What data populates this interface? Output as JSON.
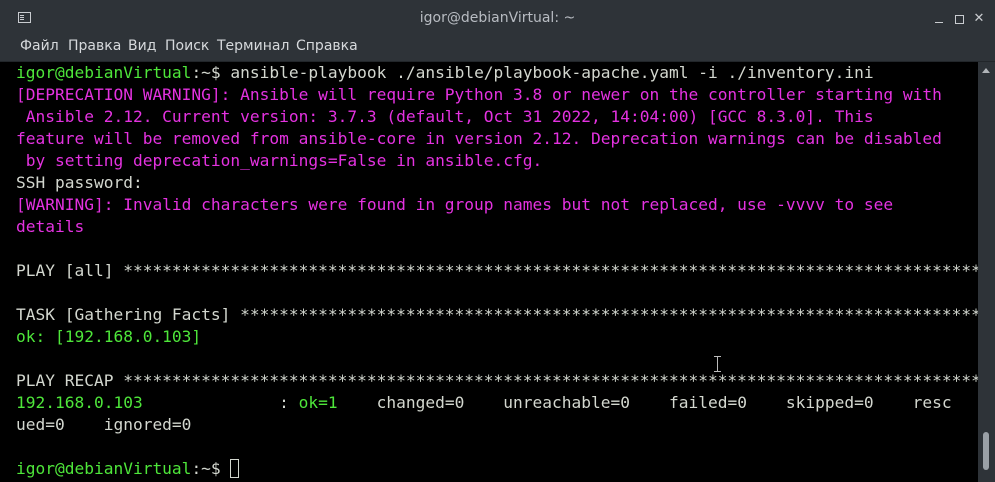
{
  "window": {
    "title": "igor@debianVirtual: ~"
  },
  "menu": {
    "items": [
      "Файл",
      "Правка",
      "Вид",
      "Поиск",
      "Терминал",
      "Справка"
    ]
  },
  "terminal": {
    "prompt_user": "igor@debianVirtual",
    "prompt_path": ":~$ ",
    "command": "ansible-playbook ./ansible/playbook-apache.yaml -i ./inventory.ini",
    "deprecation_lines": [
      "[DEPRECATION WARNING]: Ansible will require Python 3.8 or newer on the controller starting with",
      " Ansible 2.12. Current version: 3.7.3 (default, Oct 31 2022, 14:04:00) [GCC 8.3.0]. This",
      "feature will be removed from ansible-core in version 2.12. Deprecation warnings can be disabled",
      " by setting deprecation_warnings=False in ansible.cfg."
    ],
    "ssh_prompt": "SSH password:",
    "warning_lines": [
      "[WARNING]: Invalid characters were found in group names but not replaced, use -vvvv to see",
      "details"
    ],
    "play_all": "PLAY [all] ******************************************************************************************",
    "task_gather": "TASK [Gathering Facts] ******************************************************************************",
    "ok_line": "ok: [192.168.0.103]",
    "play_recap": "PLAY RECAP ******************************************************************************************",
    "recap_host": "192.168.0.103",
    "recap_colon": "              : ",
    "recap_ok": "ok=1",
    "recap_rest": "    changed=0    unreachable=0    failed=0    skipped=0    resc",
    "recap_cont": "ued=0    ignored=0"
  }
}
